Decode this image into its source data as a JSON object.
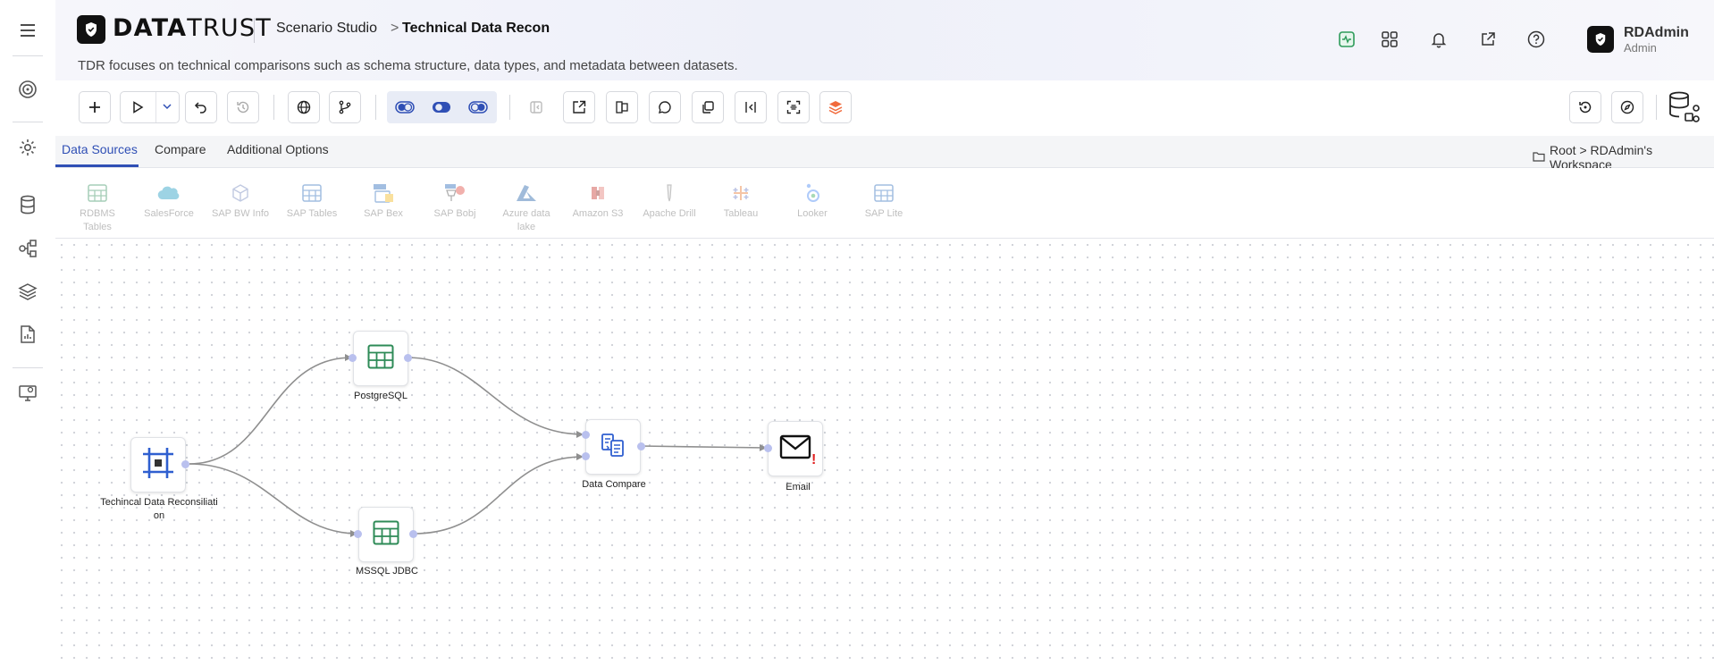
{
  "header": {
    "logo_bold": "DATA",
    "logo_light": "TRUST",
    "breadcrumb_parent": "Scenario Studio",
    "breadcrumb_separator": ">",
    "breadcrumb_current": "Technical Data Recon",
    "subtitle": "TDR focuses on technical comparisons such as schema structure, data types, and metadata between datasets."
  },
  "user": {
    "name": "RDAdmin",
    "role": "Admin"
  },
  "tabs": [
    {
      "label": "Data Sources"
    },
    {
      "label": "Compare"
    },
    {
      "label": "Additional Options"
    }
  ],
  "workspace_breadcrumb": "Root > RDAdmin's Workspace",
  "palette": [
    {
      "label": "RDBMS Tables"
    },
    {
      "label": "SalesForce"
    },
    {
      "label": "SAP BW Info"
    },
    {
      "label": "SAP Tables"
    },
    {
      "label": "SAP Bex"
    },
    {
      "label": "SAP Bobj"
    },
    {
      "label": "Azure data lake"
    },
    {
      "label": "Amazon S3"
    },
    {
      "label": "Apache Drill"
    },
    {
      "label": "Tableau"
    },
    {
      "label": "Looker"
    },
    {
      "label": "SAP Lite"
    }
  ],
  "nodes": {
    "start": {
      "label": "Techincal Data Reconsiliati on"
    },
    "postgres": {
      "label": "PostgreSQL"
    },
    "mssql": {
      "label": "MSSQL JDBC"
    },
    "compare": {
      "label": "Data Compare"
    },
    "email": {
      "label": "Email"
    }
  },
  "colors": {
    "accent": "#2f4fb5",
    "table_icon": "#2e8b57",
    "edge": "#8f8f8f",
    "handle": "#b9c0ee",
    "warning": "#e02020"
  }
}
